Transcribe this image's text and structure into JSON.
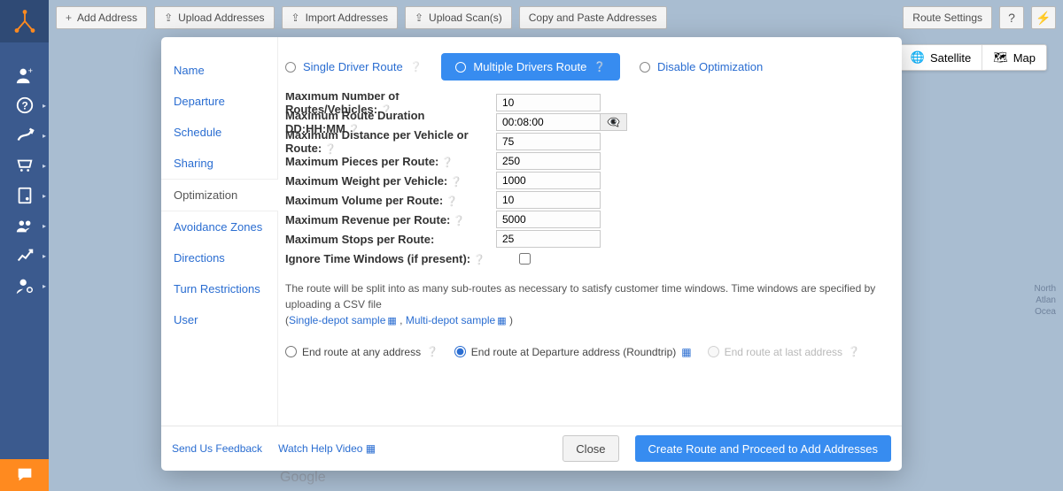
{
  "toolbar": {
    "add_address": "Add Address",
    "upload_addresses": "Upload Addresses",
    "import_addresses": "Import Addresses",
    "upload_scans": "Upload Scan(s)",
    "copy_paste": "Copy and Paste Addresses",
    "route_settings": "Route Settings"
  },
  "map": {
    "satellite": "Satellite",
    "map": "Map",
    "right_label": "North\nAtlan\nOcea",
    "google": "Google"
  },
  "modal": {
    "sidebar": {
      "items": [
        {
          "label": "Name"
        },
        {
          "label": "Departure"
        },
        {
          "label": "Schedule"
        },
        {
          "label": "Sharing"
        },
        {
          "label": "Optimization"
        },
        {
          "label": "Avoidance Zones"
        },
        {
          "label": "Directions"
        },
        {
          "label": "Turn Restrictions"
        },
        {
          "label": "User"
        }
      ],
      "active_index": 4
    },
    "tabs": {
      "single": "Single Driver Route",
      "multiple": "Multiple Drivers Route",
      "disable": "Disable Optimization"
    },
    "fields": {
      "max_routes": {
        "label": "Maximum Number of Routes/Vehicles:",
        "value": "10",
        "help": true
      },
      "max_duration": {
        "label": "Maximum Route Duration DD:HH:MM",
        "value": "00:08:00",
        "help": true,
        "duration": true
      },
      "max_distance": {
        "label": "Maximum Distance per Vehicle or Route:",
        "value": "75",
        "help": true
      },
      "max_pieces": {
        "label": "Maximum Pieces per Route:",
        "value": "250",
        "help": true
      },
      "max_weight": {
        "label": "Maximum Weight per Vehicle:",
        "value": "1000",
        "help": true
      },
      "max_volume": {
        "label": "Maximum Volume per Route:",
        "value": "10",
        "help": true
      },
      "max_revenue": {
        "label": "Maximum Revenue per Route:",
        "value": "5000",
        "help": true
      },
      "max_stops": {
        "label": "Maximum Stops per Route:",
        "value": "25",
        "help": false
      },
      "ignore_tw": {
        "label": "Ignore Time Windows (if present):",
        "help": true,
        "checkbox": true
      }
    },
    "note": {
      "text": "The route will be split into as many sub-routes as necessary to satisfy customer time windows. Time windows are specified by uploading a CSV file",
      "open": "(",
      "link1": "Single-depot sample",
      "sep": " , ",
      "link2": "Multi-depot sample",
      "close": " )"
    },
    "end_opts": {
      "any": "End route at any address",
      "roundtrip": "End route at Departure address (Roundtrip)",
      "last": "End route at last address",
      "selected": "roundtrip"
    },
    "footer": {
      "feedback": "Send Us Feedback",
      "watch": "Watch Help Video",
      "close": "Close",
      "create": "Create Route and Proceed to Add Addresses"
    }
  }
}
